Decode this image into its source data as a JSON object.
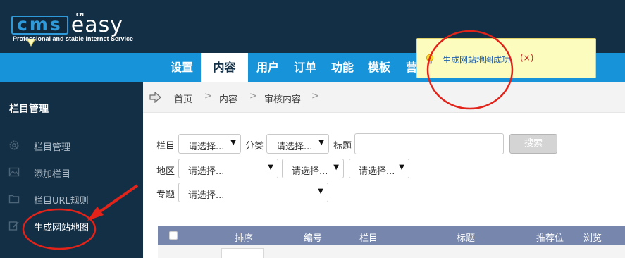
{
  "logo": {
    "brand": "cms",
    "brand_suffix": "easy",
    "badge": "CN",
    "tagline": "Professional and stable Internet Service"
  },
  "nav": {
    "items": [
      {
        "label": "设置",
        "active": false
      },
      {
        "label": "内容",
        "active": true
      },
      {
        "label": "用户",
        "active": false
      },
      {
        "label": "订单",
        "active": false
      },
      {
        "label": "功能",
        "active": false
      },
      {
        "label": "模板",
        "active": false
      },
      {
        "label": "营",
        "active": false
      }
    ]
  },
  "sidebar": {
    "title": "栏目管理",
    "items": [
      {
        "label": "栏目管理",
        "icon": "gear-icon"
      },
      {
        "label": "添加栏目",
        "icon": "image-icon"
      },
      {
        "label": "栏目URL规则",
        "icon": "folder-icon"
      },
      {
        "label": "生成网站地图",
        "icon": "edit-icon"
      }
    ]
  },
  "breadcrumb": {
    "items": [
      "首页",
      "内容",
      "审核内容"
    ],
    "separator": ">"
  },
  "filters": {
    "category_label": "栏目",
    "category_value": "请选择...",
    "type_label": "分类",
    "type_value": "请选择...",
    "title_label": "标题",
    "title_value": "",
    "search_button": "搜索",
    "region_label": "地区",
    "region_value_1": "请选择...",
    "region_value_2": "请选择...",
    "region_value_3": "请选择...",
    "topic_label": "专题",
    "topic_value": "请选择..."
  },
  "table": {
    "headers": [
      "排序",
      "编号",
      "栏目",
      "标题",
      "推荐位",
      "浏览"
    ]
  },
  "tooltip": {
    "message": "生成网站地图成功",
    "close": "(×)"
  },
  "colors": {
    "header_bg": "#132f45",
    "nav_bg": "#1794d9",
    "accent": "#2f9ad9",
    "table_head": "#7686ad",
    "annotation": "#e2231a"
  }
}
